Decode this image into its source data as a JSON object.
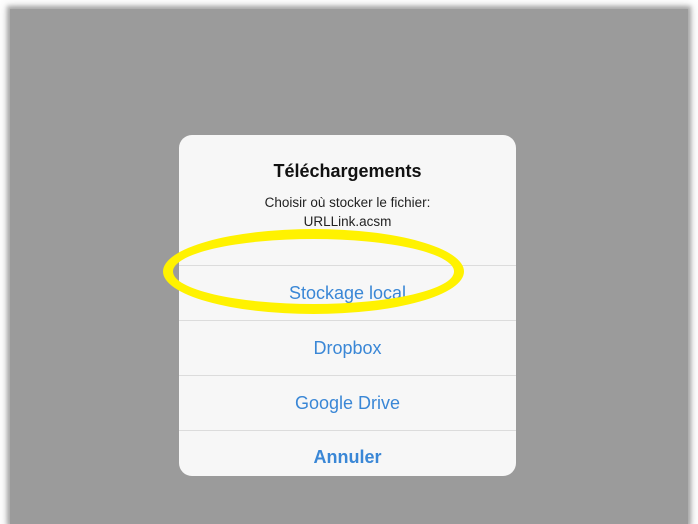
{
  "dialog": {
    "title": "Téléchargements",
    "message_line1": "Choisir où stocker le fichier:",
    "message_line2": "URLLink.acsm"
  },
  "buttons": {
    "local": "Stockage local",
    "dropbox": "Dropbox",
    "google_drive": "Google Drive",
    "cancel": "Annuler"
  },
  "colors": {
    "overlay": "#9b9b9b",
    "dialog_bg": "#f7f7f7",
    "action_blue": "#3a87d6",
    "highlight_yellow": "#fff200"
  }
}
